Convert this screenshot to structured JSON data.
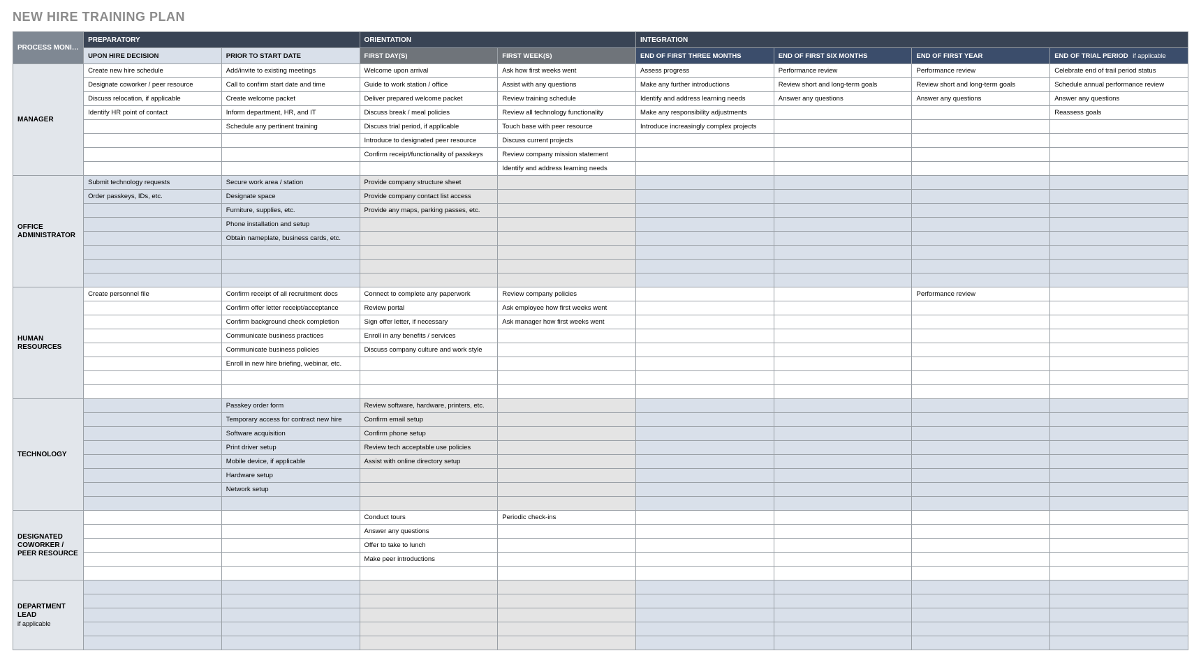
{
  "title": "NEW HIRE TRAINING PLAN",
  "headers": {
    "pm": "PROCESS MONITOR / MENTOR",
    "groups": [
      "PREPARATORY",
      "ORIENTATION",
      "INTEGRATION"
    ],
    "cols": {
      "c1": "UPON HIRE DECISION",
      "c2": "PRIOR TO START DATE",
      "c3": "FIRST DAY(S)",
      "c4": "FIRST WEEK(S)",
      "c5": "END OF FIRST THREE MONTHS",
      "c6": "END OF FIRST SIX MONTHS",
      "c7": "END OF FIRST YEAR",
      "c8": "END OF TRIAL PERIOD",
      "c8s": "if applicable"
    }
  },
  "sections": [
    {
      "role": "MANAGER",
      "sub": "",
      "shade": false,
      "rows": [
        {
          "c1": "Create new hire schedule",
          "c2": "Add/invite to existing meetings",
          "c3": "Welcome upon arrival",
          "c4": "Ask how first weeks went",
          "c5": "Assess progress",
          "c6": "Performance review",
          "c7": "Performance review",
          "c8": "Celebrate end of trail period status"
        },
        {
          "c1": "Designate coworker / peer resource",
          "c2": "Call to confirm start date and time",
          "c3": "Guide to work station / office",
          "c4": "Assist with any questions",
          "c5": "Make any further introductions",
          "c6": "Review short and long-term goals",
          "c7": "Review short and long-term goals",
          "c8": "Schedule annual performance review"
        },
        {
          "c1": "Discuss relocation, if applicable",
          "c2": "Create welcome packet",
          "c3": "Deliver prepared welcome packet",
          "c4": "Review training schedule",
          "c5": "Identify and address learning needs",
          "c6": "Answer any questions",
          "c7": "Answer any questions",
          "c8": "Answer any questions"
        },
        {
          "c1": "Identify HR point of contact",
          "c2": "Inform department, HR, and IT",
          "c3": "Discuss break / meal policies",
          "c4": "Review all technology functionality",
          "c5": "Make any responsibility adjustments",
          "c6": "",
          "c7": "",
          "c8": "Reassess goals"
        },
        {
          "c1": "",
          "c2": "Schedule any pertinent training",
          "c3": "Discuss trial period, if applicable",
          "c4": "Touch base with peer resource",
          "c5": "Introduce increasingly complex projects",
          "c6": "",
          "c7": "",
          "c8": ""
        },
        {
          "c1": "",
          "c2": "",
          "c3": "Introduce to designated peer resource",
          "c4": "Discuss current projects",
          "c5": "",
          "c6": "",
          "c7": "",
          "c8": ""
        },
        {
          "c1": "",
          "c2": "",
          "c3": "Confirm receipt/functionality of passkeys",
          "c4": "Review company mission statement",
          "c5": "",
          "c6": "",
          "c7": "",
          "c8": ""
        },
        {
          "c1": "",
          "c2": "",
          "c3": "",
          "c4": "Identify and address learning needs",
          "c5": "",
          "c6": "",
          "c7": "",
          "c8": ""
        }
      ]
    },
    {
      "role": "OFFICE ADMINISTRATOR",
      "sub": "",
      "shade": true,
      "rows": [
        {
          "c1": "Submit technology requests",
          "c2": "Secure work area / station",
          "c3": "Provide company structure sheet",
          "c4": "",
          "c5": "",
          "c6": "",
          "c7": "",
          "c8": ""
        },
        {
          "c1": "Order passkeys, IDs, etc.",
          "c2": "Designate space",
          "c3": "Provide company contact list access",
          "c4": "",
          "c5": "",
          "c6": "",
          "c7": "",
          "c8": ""
        },
        {
          "c1": "",
          "c2": "Furniture, supplies, etc.",
          "c3": "Provide any maps, parking passes, etc.",
          "c4": "",
          "c5": "",
          "c6": "",
          "c7": "",
          "c8": ""
        },
        {
          "c1": "",
          "c2": "Phone installation and setup",
          "c3": "",
          "c4": "",
          "c5": "",
          "c6": "",
          "c7": "",
          "c8": ""
        },
        {
          "c1": "",
          "c2": "Obtain nameplate, business cards, etc.",
          "c3": "",
          "c4": "",
          "c5": "",
          "c6": "",
          "c7": "",
          "c8": ""
        },
        {
          "c1": "",
          "c2": "",
          "c3": "",
          "c4": "",
          "c5": "",
          "c6": "",
          "c7": "",
          "c8": ""
        },
        {
          "c1": "",
          "c2": "",
          "c3": "",
          "c4": "",
          "c5": "",
          "c6": "",
          "c7": "",
          "c8": ""
        },
        {
          "c1": "",
          "c2": "",
          "c3": "",
          "c4": "",
          "c5": "",
          "c6": "",
          "c7": "",
          "c8": ""
        }
      ]
    },
    {
      "role": "HUMAN RESOURCES",
      "sub": "",
      "shade": false,
      "rows": [
        {
          "c1": "Create personnel file",
          "c2": "Confirm receipt of all recruitment docs",
          "c3": "Connect to complete any paperwork",
          "c4": "Review company policies",
          "c5": "",
          "c6": "",
          "c7": "Performance review",
          "c8": ""
        },
        {
          "c1": "",
          "c2": "Confirm offer letter receipt/acceptance",
          "c3": "Review portal",
          "c4": "Ask employee how first weeks went",
          "c5": "",
          "c6": "",
          "c7": "",
          "c8": ""
        },
        {
          "c1": "",
          "c2": "Confirm background check completion",
          "c3": "Sign offer letter, if necessary",
          "c4": "Ask manager how first weeks went",
          "c5": "",
          "c6": "",
          "c7": "",
          "c8": ""
        },
        {
          "c1": "",
          "c2": "Communicate business practices",
          "c3": "Enroll in any benefits / services",
          "c4": "",
          "c5": "",
          "c6": "",
          "c7": "",
          "c8": ""
        },
        {
          "c1": "",
          "c2": "Communicate business policies",
          "c3": "Discuss company culture and work style",
          "c4": "",
          "c5": "",
          "c6": "",
          "c7": "",
          "c8": ""
        },
        {
          "c1": "",
          "c2": "Enroll in new hire briefing, webinar, etc.",
          "c3": "",
          "c4": "",
          "c5": "",
          "c6": "",
          "c7": "",
          "c8": ""
        },
        {
          "c1": "",
          "c2": "",
          "c3": "",
          "c4": "",
          "c5": "",
          "c6": "",
          "c7": "",
          "c8": ""
        },
        {
          "c1": "",
          "c2": "",
          "c3": "",
          "c4": "",
          "c5": "",
          "c6": "",
          "c7": "",
          "c8": ""
        }
      ]
    },
    {
      "role": "TECHNOLOGY",
      "sub": "",
      "shade": true,
      "rows": [
        {
          "c1": "",
          "c2": "Passkey order form",
          "c3": "Review software, hardware, printers, etc.",
          "c4": "",
          "c5": "",
          "c6": "",
          "c7": "",
          "c8": ""
        },
        {
          "c1": "",
          "c2": "Temporary access for contract new hire",
          "c3": "Confirm email setup",
          "c4": "",
          "c5": "",
          "c6": "",
          "c7": "",
          "c8": ""
        },
        {
          "c1": "",
          "c2": "Software acquisition",
          "c3": "Confirm phone setup",
          "c4": "",
          "c5": "",
          "c6": "",
          "c7": "",
          "c8": ""
        },
        {
          "c1": "",
          "c2": "Print driver setup",
          "c3": "Review tech acceptable use policies",
          "c4": "",
          "c5": "",
          "c6": "",
          "c7": "",
          "c8": ""
        },
        {
          "c1": "",
          "c2": "Mobile device, if applicable",
          "c3": "Assist with online directory setup",
          "c4": "",
          "c5": "",
          "c6": "",
          "c7": "",
          "c8": ""
        },
        {
          "c1": "",
          "c2": "Hardware setup",
          "c3": "",
          "c4": "",
          "c5": "",
          "c6": "",
          "c7": "",
          "c8": ""
        },
        {
          "c1": "",
          "c2": "Network setup",
          "c3": "",
          "c4": "",
          "c5": "",
          "c6": "",
          "c7": "",
          "c8": ""
        },
        {
          "c1": "",
          "c2": "",
          "c3": "",
          "c4": "",
          "c5": "",
          "c6": "",
          "c7": "",
          "c8": ""
        }
      ]
    },
    {
      "role": "DESIGNATED COWORKER / PEER RESOURCE",
      "sub": "",
      "shade": false,
      "rows": [
        {
          "c1": "",
          "c2": "",
          "c3": "Conduct tours",
          "c4": "Periodic check-ins",
          "c5": "",
          "c6": "",
          "c7": "",
          "c8": ""
        },
        {
          "c1": "",
          "c2": "",
          "c3": "Answer any questions",
          "c4": "",
          "c5": "",
          "c6": "",
          "c7": "",
          "c8": ""
        },
        {
          "c1": "",
          "c2": "",
          "c3": "Offer to take to lunch",
          "c4": "",
          "c5": "",
          "c6": "",
          "c7": "",
          "c8": ""
        },
        {
          "c1": "",
          "c2": "",
          "c3": "Make peer introductions",
          "c4": "",
          "c5": "",
          "c6": "",
          "c7": "",
          "c8": ""
        },
        {
          "c1": "",
          "c2": "",
          "c3": "",
          "c4": "",
          "c5": "",
          "c6": "",
          "c7": "",
          "c8": ""
        }
      ]
    },
    {
      "role": "DEPARTMENT LEAD",
      "sub": "if applicable",
      "shade": true,
      "rows": [
        {
          "c1": "",
          "c2": "",
          "c3": "",
          "c4": "",
          "c5": "",
          "c6": "",
          "c7": "",
          "c8": ""
        },
        {
          "c1": "",
          "c2": "",
          "c3": "",
          "c4": "",
          "c5": "",
          "c6": "",
          "c7": "",
          "c8": ""
        },
        {
          "c1": "",
          "c2": "",
          "c3": "",
          "c4": "",
          "c5": "",
          "c6": "",
          "c7": "",
          "c8": ""
        },
        {
          "c1": "",
          "c2": "",
          "c3": "",
          "c4": "",
          "c5": "",
          "c6": "",
          "c7": "",
          "c8": ""
        },
        {
          "c1": "",
          "c2": "",
          "c3": "",
          "c4": "",
          "c5": "",
          "c6": "",
          "c7": "",
          "c8": ""
        }
      ]
    }
  ]
}
